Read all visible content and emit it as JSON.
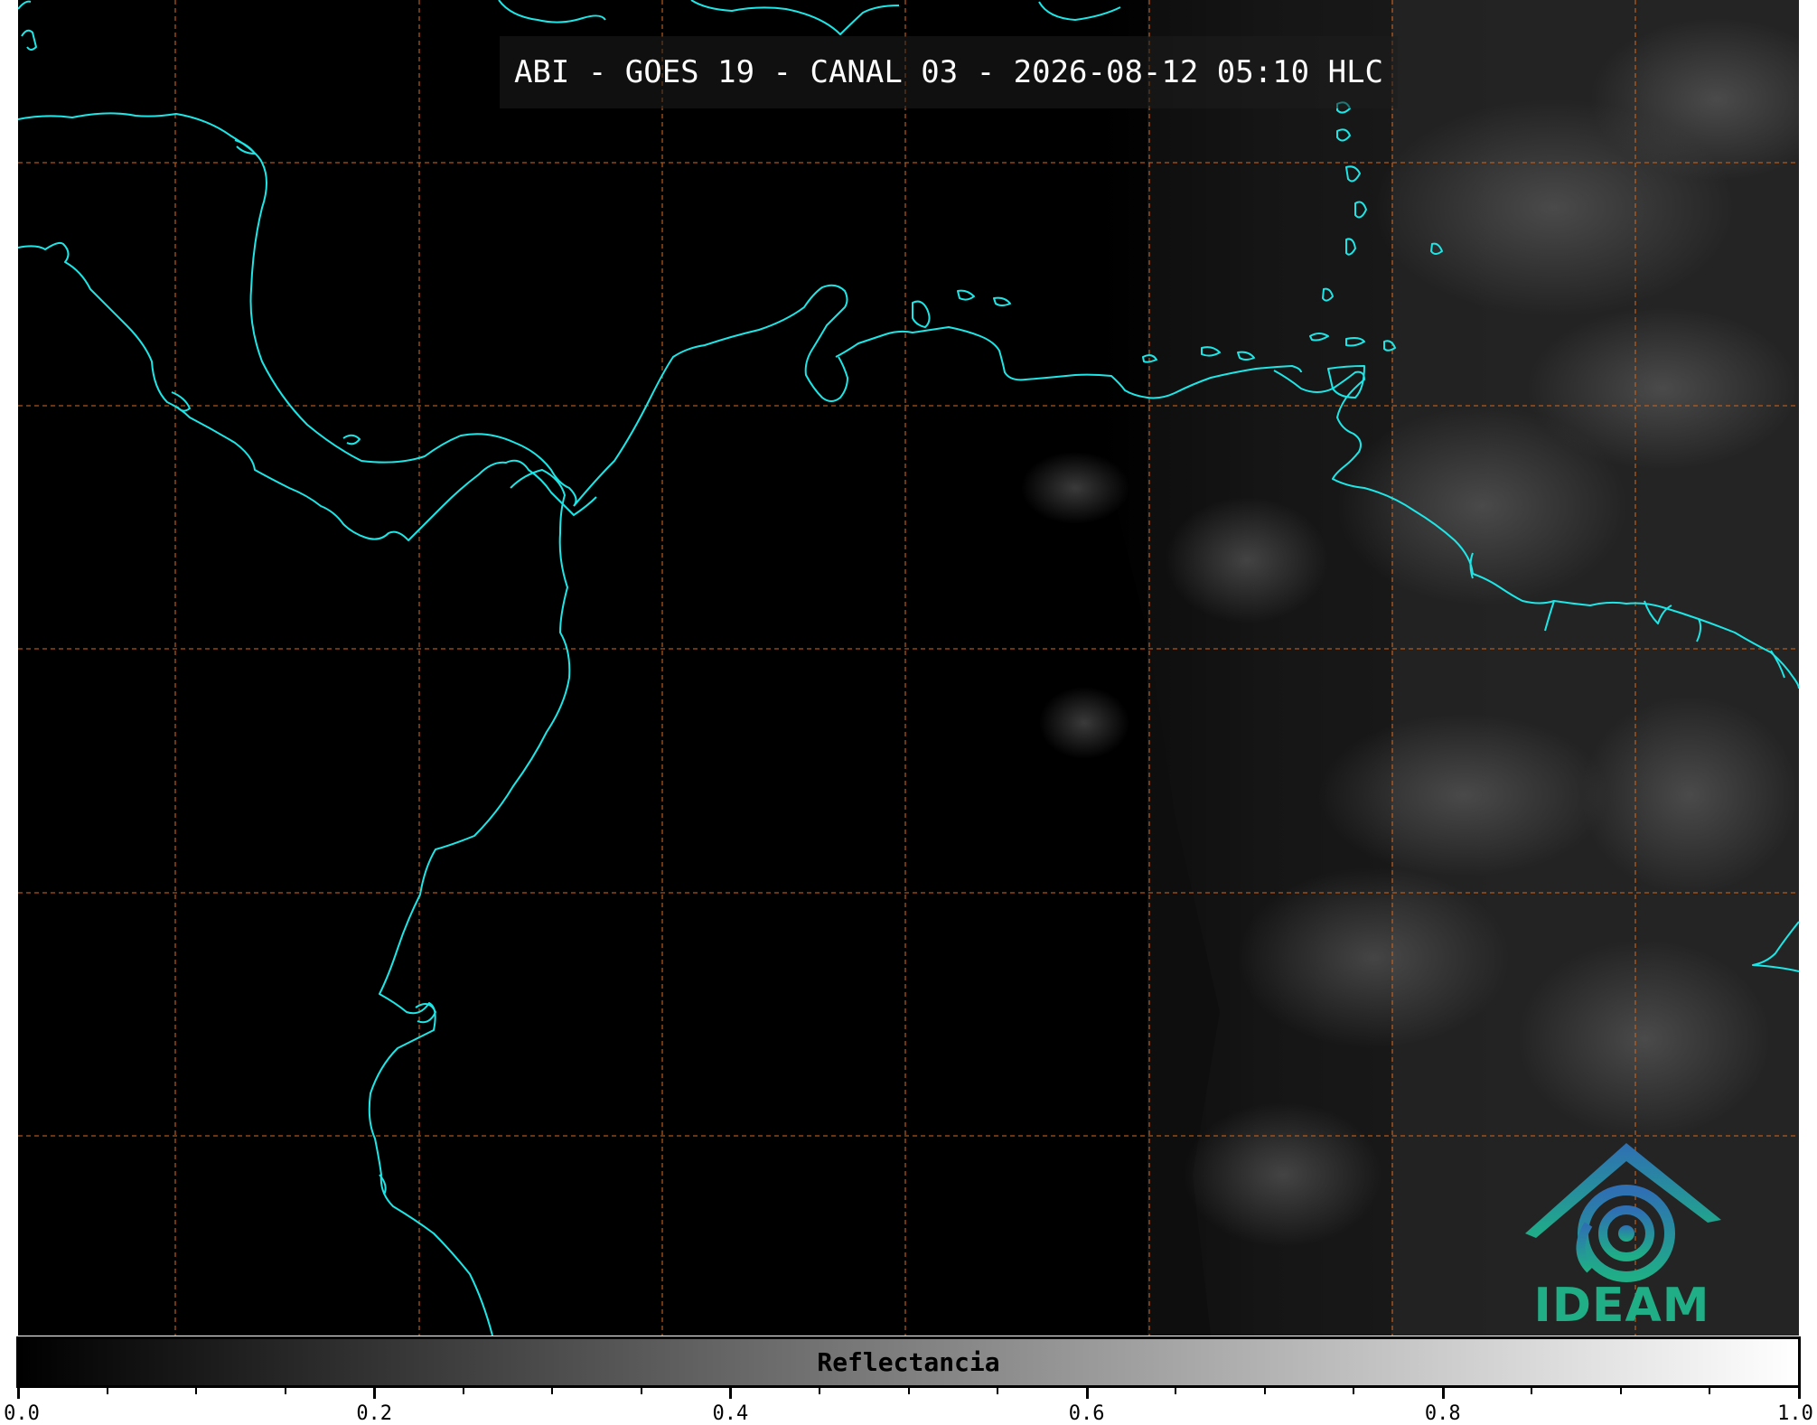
{
  "title": "ABI - GOES 19 - CANAL 03 - 2026-08-12 05:10 HLC",
  "colorbar": {
    "label": "Reflectancia",
    "range": [
      0.0,
      1.0
    ],
    "tick_labels": [
      "0.0",
      "0.2",
      "0.4",
      "0.6",
      "0.8",
      "1.0"
    ],
    "major_ticks": [
      0.0,
      0.2,
      0.4,
      0.6,
      0.8,
      1.0
    ],
    "minor_step": 0.05,
    "colormap": [
      "#000000",
      "#ffffff"
    ]
  },
  "logo": {
    "text": "IDEAM"
  },
  "colors": {
    "coastline": "#1fe6e6",
    "gridlines": "#c8641e",
    "background": "#000000",
    "logo_blue": "#2f6fb4",
    "logo_green": "#1fae86"
  }
}
